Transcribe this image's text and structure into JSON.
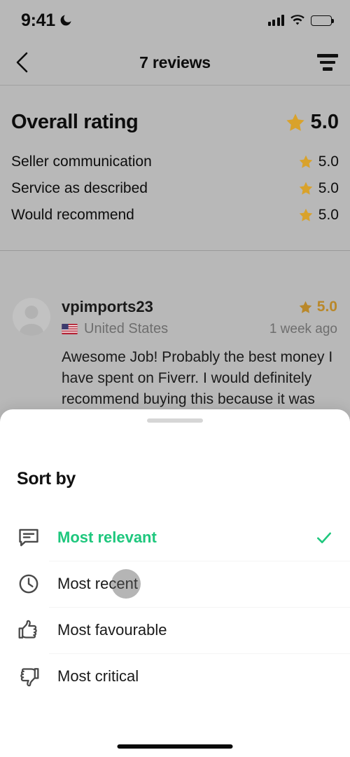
{
  "theme": {
    "green": "#1ec77d",
    "gold": "#d9a22b",
    "review_gold": "#b9882a",
    "dim_background": "#b8b8b8",
    "sheet_background": "#ffffff"
  },
  "status_bar": {
    "time": "9:41",
    "dnd_icon": "crescent-moon-icon",
    "signal_icon": "cellular-signal-icon",
    "wifi_icon": "wifi-icon",
    "battery_icon": "battery-full-icon"
  },
  "navbar": {
    "back_icon": "chevron-left-icon",
    "title": "7 reviews",
    "sort_icon": "sort-filter-icon"
  },
  "ratings": {
    "overall": {
      "label": "Overall rating",
      "value": "5.0",
      "star_icon": "star-filled-icon"
    },
    "breakdown": [
      {
        "label": "Seller communication",
        "value": "5.0",
        "star_icon": "star-filled-icon"
      },
      {
        "label": "Service as described",
        "value": "5.0",
        "star_icon": "star-filled-icon"
      },
      {
        "label": "Would recommend",
        "value": "5.0",
        "star_icon": "star-filled-icon"
      }
    ]
  },
  "review": {
    "avatar_icon": "user-avatar-placeholder-icon",
    "username": "vpimports23",
    "rating": "5.0",
    "star_icon": "star-filled-icon",
    "flag_icon": "flag-united-states-icon",
    "country": "United States",
    "time_ago": "1 week ago",
    "text": "Awesome Job! Probably the best money I have spent on Fiverr. I would definitely recommend buying this because it was fast affordable price and turns out amazing. It was fast and very"
  },
  "sheet": {
    "handle": "drag-handle",
    "title": "Sort by",
    "options": [
      {
        "label": "Most relevant",
        "icon": "speech-bubble-icon",
        "selected": true,
        "check_icon": "checkmark-icon"
      },
      {
        "label": "Most recent",
        "icon": "clock-icon",
        "selected": false
      },
      {
        "label": "Most favourable",
        "icon": "thumbs-up-icon",
        "selected": false
      },
      {
        "label": "Most critical",
        "icon": "thumbs-down-icon",
        "selected": false
      }
    ]
  },
  "home_indicator": "home-indicator"
}
